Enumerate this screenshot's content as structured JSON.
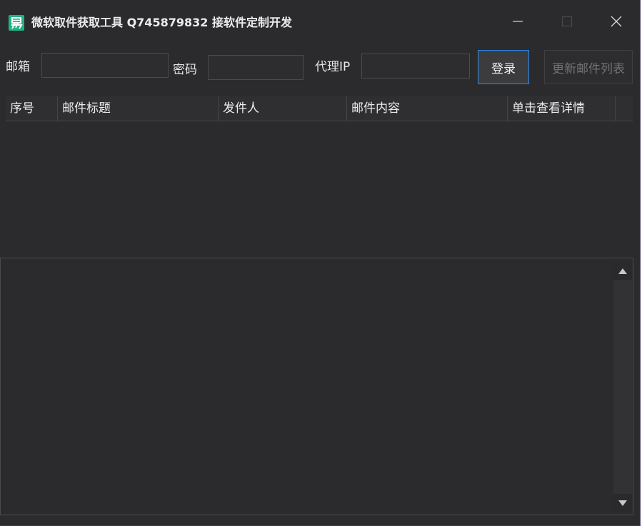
{
  "window": {
    "title": "微软取件获取工具 Q745879832 接软件定制开发",
    "app_icon": "yi-logo-icon",
    "controls": [
      "minimize-icon",
      "maximize-icon",
      "close-icon"
    ]
  },
  "form": {
    "email_label": "邮箱",
    "email_value": "",
    "password_label": "密码",
    "password_value": "",
    "proxy_label": "代理IP",
    "proxy_value": "",
    "login_button": "登录",
    "refresh_button": "更新邮件列表"
  },
  "table": {
    "columns": [
      "序号",
      "邮件标题",
      "发件人",
      "邮件内容",
      "单击查看详情"
    ],
    "rows": []
  },
  "colors": {
    "background": "#2b2b2d",
    "accent": "#2e8ae6",
    "app_icon": "#21b283"
  }
}
